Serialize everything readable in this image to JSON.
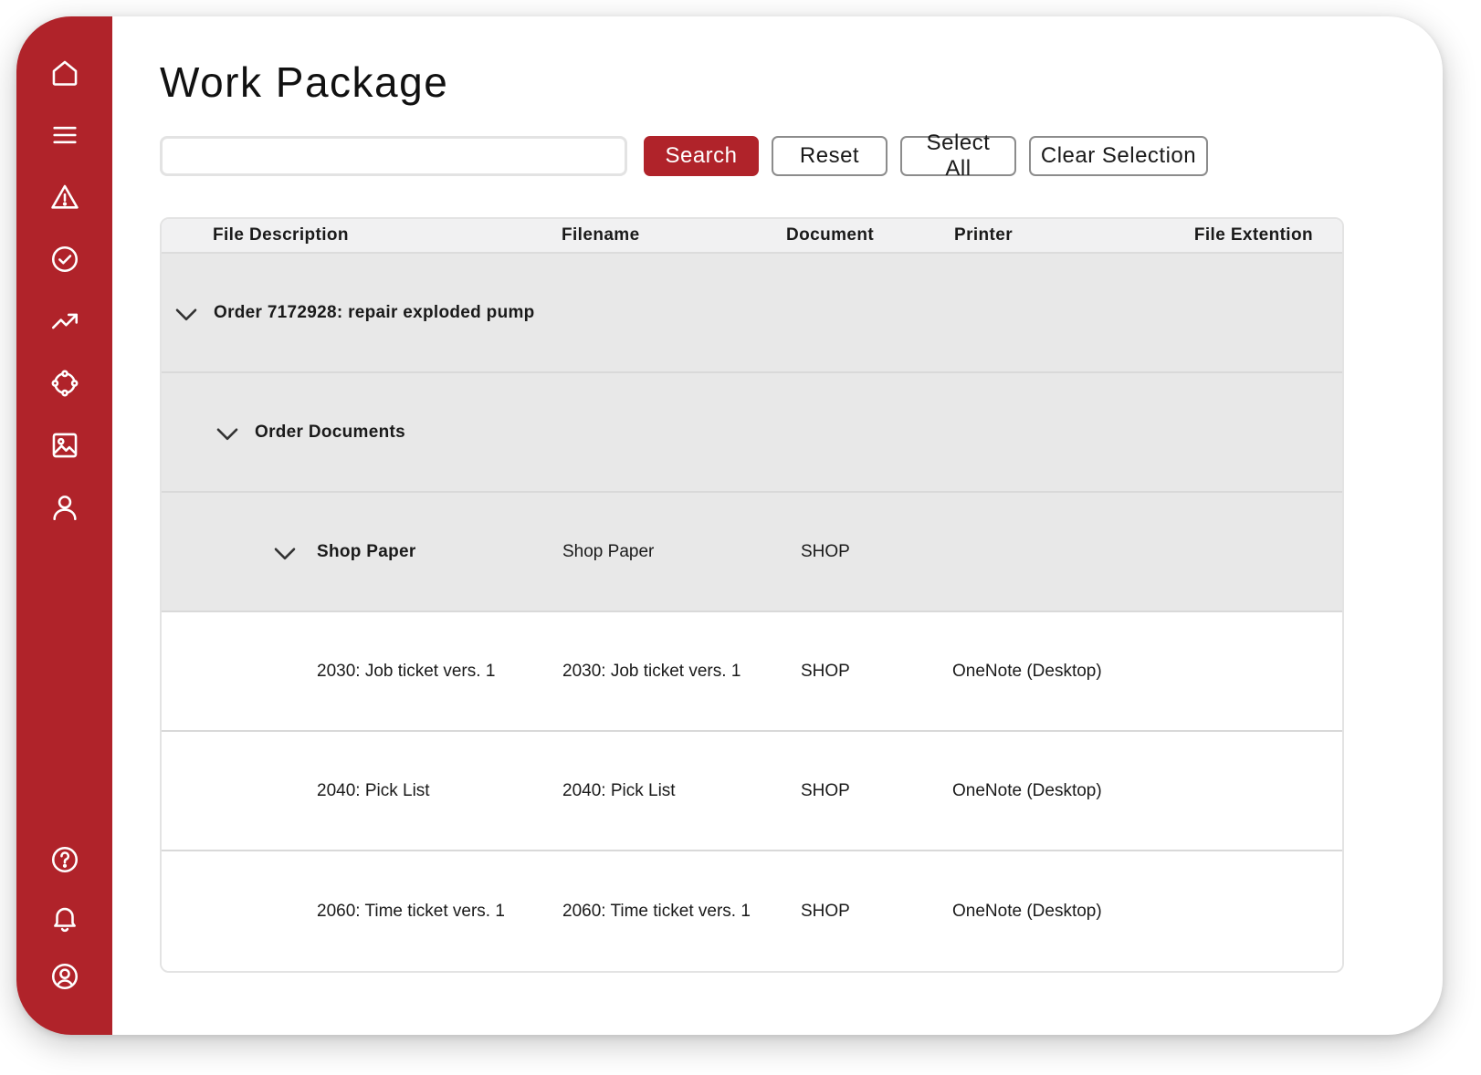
{
  "page": {
    "title": "Work Package"
  },
  "colors": {
    "accent": "#b0232a",
    "group_row": "#e8e8e8",
    "header_row": "#f1f1f2"
  },
  "sidebar": {
    "top_items": [
      {
        "icon": "home-icon"
      },
      {
        "icon": "menu-icon"
      },
      {
        "icon": "warning-icon"
      },
      {
        "icon": "check-circle-icon"
      },
      {
        "icon": "trending-up-icon"
      },
      {
        "icon": "network-icon"
      },
      {
        "icon": "image-icon"
      },
      {
        "icon": "user-icon"
      }
    ],
    "bottom_items": [
      {
        "icon": "help-icon"
      },
      {
        "icon": "bell-icon"
      },
      {
        "icon": "account-icon"
      }
    ]
  },
  "toolbar": {
    "search_value": "",
    "search_placeholder": "",
    "search_label": "Search",
    "reset_label": "Reset",
    "select_all_label": "Select All",
    "clear_selection_label": "Clear Selection"
  },
  "table": {
    "columns": [
      "File Description",
      "Filename",
      "Document",
      "Printer",
      "File Extention"
    ],
    "rows": [
      {
        "kind": "group",
        "level": 0,
        "description": "Order 7172928: repair exploded pump",
        "filename": "",
        "document": "",
        "printer": "",
        "extension": ""
      },
      {
        "kind": "group",
        "level": 1,
        "description": "Order Documents",
        "filename": "",
        "document": "",
        "printer": "",
        "extension": ""
      },
      {
        "kind": "group",
        "level": 2,
        "description": "Shop Paper",
        "filename": "Shop Paper",
        "document": "SHOP",
        "printer": "",
        "extension": ""
      },
      {
        "kind": "leaf",
        "level": 3,
        "description": "2030: Job ticket vers. 1",
        "filename": "2030: Job ticket vers. 1",
        "document": "SHOP",
        "printer": "OneNote (Desktop)",
        "extension": ""
      },
      {
        "kind": "leaf",
        "level": 3,
        "description": "2040: Pick List",
        "filename": "2040: Pick List",
        "document": "SHOP",
        "printer": "OneNote (Desktop)",
        "extension": ""
      },
      {
        "kind": "leaf",
        "level": 3,
        "description": "2060: Time ticket vers. 1",
        "filename": "2060: Time ticket vers. 1",
        "document": "SHOP",
        "printer": "OneNote (Desktop)",
        "extension": ""
      }
    ]
  }
}
